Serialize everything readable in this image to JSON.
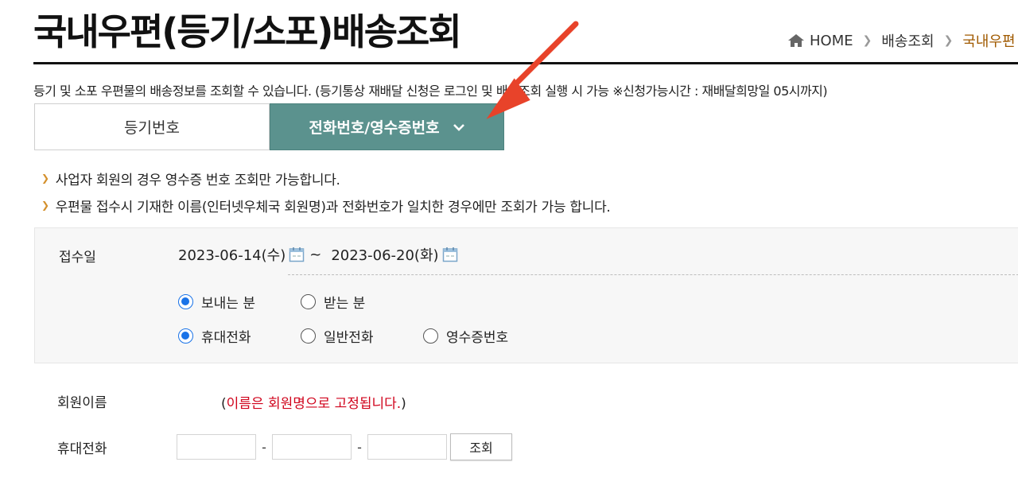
{
  "header": {
    "title": "국내우편(등기/소포)배송조회",
    "breadcrumb": {
      "home": "HOME",
      "level1": "배송조회",
      "current": "국내우편"
    }
  },
  "description": "등기 및 소포 우편물의 배송정보를 조회할 수 있습니다. (등기통상 재배달 신청은 로그인 및 배송조회 실행 시 가능 ※신청가능시간 : 재배달희망일 05시까지)",
  "tabs": [
    {
      "label": "등기번호",
      "active": false
    },
    {
      "label": "전화번호/영수증번호",
      "active": true
    }
  ],
  "notes": [
    "사업자 회원의 경우 영수증 번호 조회만 가능합니다.",
    "우편물 접수시 기재한 이름(인터넷우체국 회원명)과 전화번호가 일치한 경우에만 조회가 가능 합니다."
  ],
  "form": {
    "date_label": "접수일",
    "date_from": "2023-06-14(수)",
    "date_tilde": "~",
    "date_to": "2023-06-20(화)",
    "sender_options": [
      {
        "label": "보내는 분",
        "checked": true
      },
      {
        "label": "받는 분",
        "checked": false
      }
    ],
    "type_options": [
      {
        "label": "휴대전화",
        "checked": true
      },
      {
        "label": "일반전화",
        "checked": false
      },
      {
        "label": "영수증번호",
        "checked": false
      }
    ],
    "member_label": "회원이름",
    "member_note_open": "(",
    "member_note_text": "이름은 회원명으로 고정됩니다.",
    "member_note_close": ")",
    "phone_label": "휴대전화",
    "phone_parts": [
      "",
      "",
      ""
    ],
    "dash": "-",
    "submit_label": "조회"
  },
  "colors": {
    "active_tab": "#5b928e",
    "accent_red": "#d0021b",
    "breadcrumb_current": "#a05a00",
    "bullet": "#d4902c",
    "annotation_arrow": "#e8432a"
  }
}
